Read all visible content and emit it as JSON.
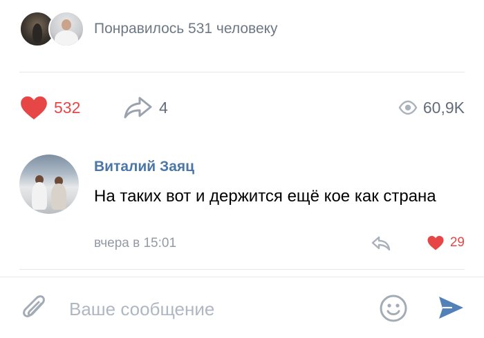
{
  "post": {
    "liked_by_text": "Понравилось 531 человеку",
    "likes_count": "532",
    "shares_count": "4",
    "views_count": "60,9K"
  },
  "comment": {
    "author": "Виталий Заяц",
    "text": "На таких вот и держится ещё кое как страна",
    "time": "вчера в 15:01",
    "likes_count": "29"
  },
  "composer": {
    "placeholder": "Ваше сообщение"
  },
  "icons": {
    "like": "heart-icon",
    "share": "share-arrow-icon",
    "views": "eye-icon",
    "reply": "reply-icon",
    "attach": "paperclip-icon",
    "emoji": "smiley-icon",
    "send": "send-icon"
  },
  "colors": {
    "like_red": "#e64646",
    "author_blue": "#4a76a8",
    "send_blue": "#5181b8",
    "secondary_gray": "#6d7885"
  }
}
